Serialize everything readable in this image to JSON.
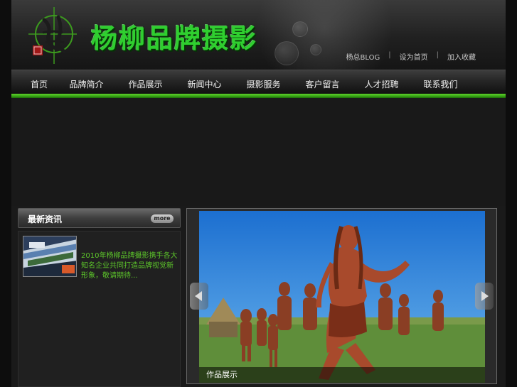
{
  "header": {
    "site_title": "杨柳品牌摄影",
    "top_links": [
      "杨总BLOG",
      "设为首页",
      "加入收藏"
    ],
    "separators": [
      "|",
      "|"
    ]
  },
  "nav": {
    "items": [
      "首页",
      "品牌简介",
      "作品展示",
      "新闻中心",
      "摄影服务",
      "客户留言",
      "人才招聘",
      "联系我们"
    ]
  },
  "news": {
    "title": "最新资讯",
    "more_label": "more",
    "item_text": "2010年杨柳品牌摄影携手各大知名企业共同打造品牌视觉新形象，敬请期待..."
  },
  "slideshow": {
    "caption": "作品展示"
  },
  "colors": {
    "accent_green": "#36a114",
    "title_green": "#2fcf2f",
    "news_text_green": "#5cc42a"
  }
}
